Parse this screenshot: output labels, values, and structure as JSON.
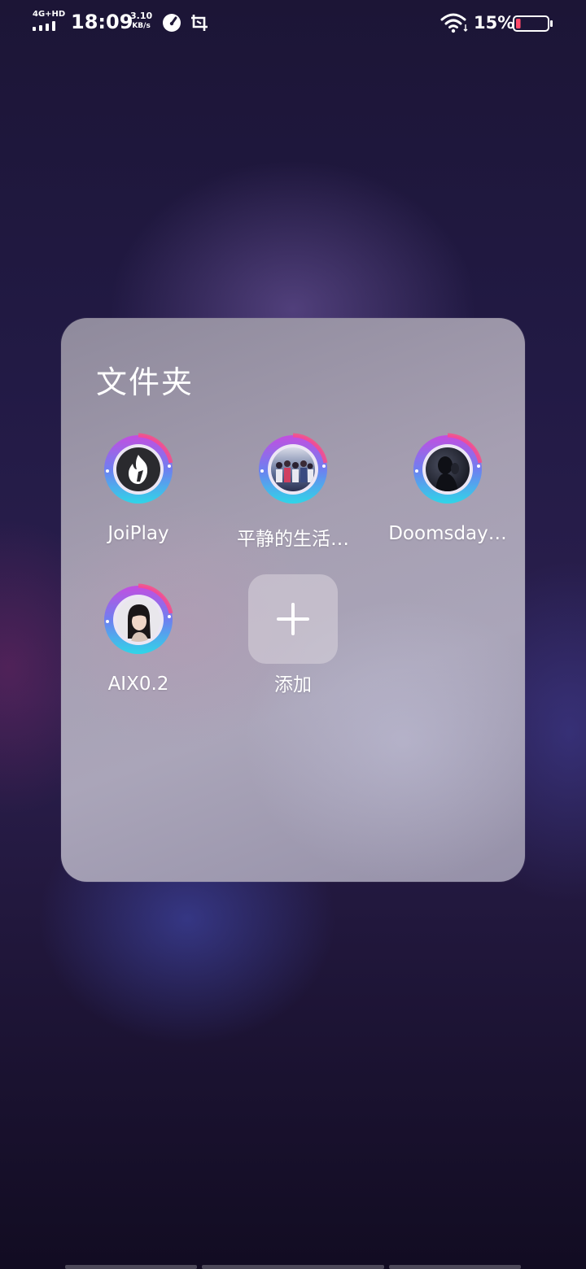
{
  "status_bar": {
    "network": "4G+HD",
    "time": "18:09",
    "speed_value": "3.10",
    "speed_unit": "KB/s",
    "battery_percent": "15%",
    "battery_level": 0.15,
    "icons": [
      "signal-icon",
      "speed-gauge-icon",
      "screenshot-icon",
      "wifi-icon",
      "battery-icon"
    ]
  },
  "folder": {
    "title": "文件夹",
    "apps": [
      {
        "label": "JoiPlay",
        "icon": "joiplay-fire-icon"
      },
      {
        "label": "平静的生活…",
        "icon": "app-avatar-group"
      },
      {
        "label": "Doomsday…",
        "icon": "app-avatar-dark"
      },
      {
        "label": "AIX0.2",
        "icon": "app-avatar-girl"
      }
    ],
    "add_label": "添加"
  },
  "colors": {
    "ring_cyan": "#2fd6e8",
    "ring_magenta": "#e23bd4",
    "ring_pink": "#ff4a86"
  }
}
